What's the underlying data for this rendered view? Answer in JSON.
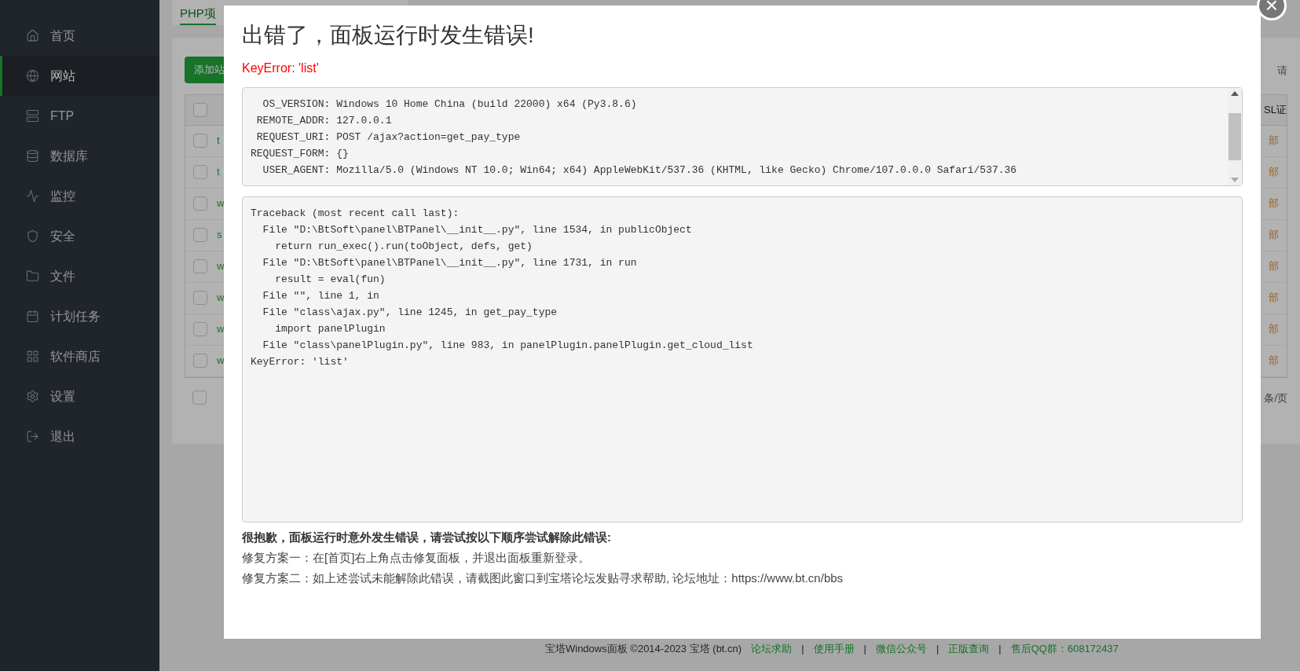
{
  "sidebar": {
    "items": [
      {
        "label": "首页",
        "selected": false
      },
      {
        "label": "网站",
        "selected": true
      },
      {
        "label": "FTP",
        "selected": false
      },
      {
        "label": "数据库",
        "selected": false
      },
      {
        "label": "监控",
        "selected": false
      },
      {
        "label": "安全",
        "selected": false
      },
      {
        "label": "文件",
        "selected": false
      },
      {
        "label": "计划任务",
        "selected": false
      },
      {
        "label": "软件商店",
        "selected": false
      },
      {
        "label": "设置",
        "selected": false
      },
      {
        "label": "退出",
        "selected": false
      }
    ]
  },
  "background": {
    "tab": "PHP项",
    "add_button": "添加站",
    "right_header": "请",
    "right_column_header": "SL证",
    "header_checked": false,
    "rows": [
      {
        "first": "t",
        "last": "部",
        "checked": false
      },
      {
        "first": "t",
        "last": "部",
        "checked": false
      },
      {
        "first": "w",
        "last": "部",
        "checked": false
      },
      {
        "first": "s",
        "last": "部",
        "checked": false
      },
      {
        "first": "w",
        "last": "部",
        "checked": false
      },
      {
        "first": "w",
        "last": "部",
        "checked": false
      },
      {
        "first": "w",
        "last": "部",
        "checked": false
      },
      {
        "first": "w",
        "last": "部",
        "checked": false
      }
    ],
    "footer_checked": false,
    "pagination": "条/页"
  },
  "dialog": {
    "title": "出错了，面板运行时发生错误!",
    "error": "KeyError: 'list'",
    "info_lines": [
      "  OS_VERSION: Windows 10 Home China (build 22000) x64 (Py3.8.6)",
      " REMOTE_ADDR: 127.0.0.1",
      " REQUEST_URI: POST /ajax?action=get_pay_type",
      "REQUEST_FORM: {}",
      "  USER_AGENT: Mozilla/5.0 (Windows NT 10.0; Win64; x64) AppleWebKit/537.36 (KHTML, like Gecko) Chrome/107.0.0.0 Safari/537.36"
    ],
    "traceback": [
      "Traceback (most recent call last):",
      "  File \"D:\\BtSoft\\panel\\BTPanel\\__init__.py\", line 1534, in publicObject",
      "    return run_exec().run(toObject, defs, get)",
      "  File \"D:\\BtSoft\\panel\\BTPanel\\__init__.py\", line 1731, in run",
      "    result = eval(fun)",
      "  File \"\", line 1, in",
      "  File \"class\\ajax.py\", line 1245, in get_pay_type",
      "    import panelPlugin",
      "  File \"class\\panelPlugin.py\", line 983, in panelPlugin.panelPlugin.get_cloud_list",
      "KeyError: 'list'"
    ],
    "help_title": "很抱歉，面板运行时意外发生错误，请尝试按以下顺序尝试解除此错误:",
    "help_lines": [
      "修复方案一：在[首页]右上角点击修复面板，并退出面板重新登录。",
      "修复方案二：如上述尝试未能解除此错误，请截图此窗口到宝塔论坛发贴寻求帮助, 论坛地址：https://www.bt.cn/bbs"
    ],
    "close": "×"
  },
  "footer": {
    "copyright": "宝塔Windows面板 ©2014-2023 宝塔 (bt.cn)",
    "links": [
      "论坛求助",
      "使用手册",
      "微信公众号",
      "正版查询",
      "售后QQ群：608172437"
    ],
    "separator": "|"
  }
}
